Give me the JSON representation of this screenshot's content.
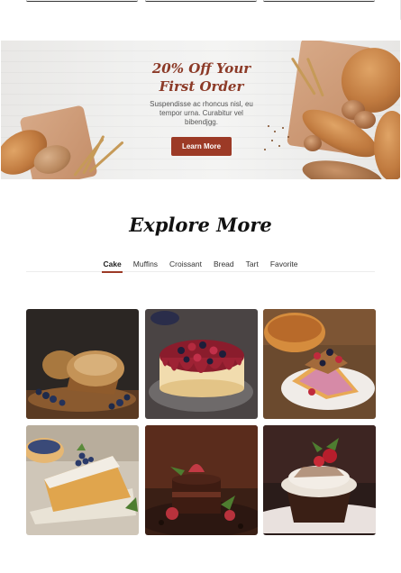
{
  "banner": {
    "title_line1": "20% Off Your",
    "title_line2": "First Order",
    "description": "Suspendisse ac rhoncus nisl, eu tempor urna. Curabitur vel bibendjgg.",
    "button_label": "Learn More"
  },
  "explore": {
    "title": "Explore More",
    "tabs": [
      {
        "label": "Cake",
        "active": true
      },
      {
        "label": "Muffins",
        "active": false
      },
      {
        "label": "Croissant",
        "active": false
      },
      {
        "label": "Bread",
        "active": false
      },
      {
        "label": "Tart",
        "active": false
      },
      {
        "label": "Favorite",
        "active": false
      }
    ]
  },
  "gallery": {
    "items": [
      {
        "name": "blueberry-muffin-photo"
      },
      {
        "name": "berry-cheesecake-photo"
      },
      {
        "name": "berry-tart-photo"
      },
      {
        "name": "pound-cake-photo"
      },
      {
        "name": "chocolate-raspberry-cake-photo"
      },
      {
        "name": "cherry-cupcake-photo"
      }
    ]
  },
  "colors": {
    "accent": "#9c3a26",
    "title_accent": "#8c3a27"
  }
}
